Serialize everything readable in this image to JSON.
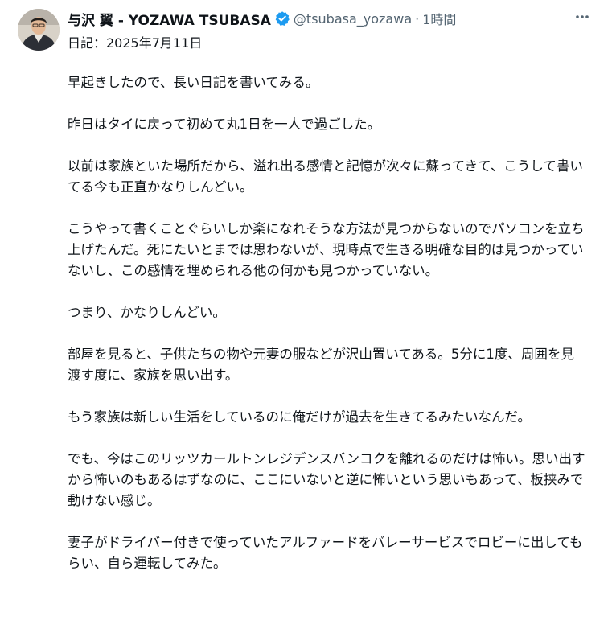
{
  "author": {
    "display_name": "与沢 翼 - YOZAWA TSUBASA",
    "handle": "@tsubasa_yozawa",
    "separator": "·",
    "time_ago": "1時間",
    "verified": true,
    "verified_color": "#1d9bf0"
  },
  "icons": {
    "avatar": "profile-photo",
    "verified": "verified-badge-icon",
    "more": "more-horizontal-icon"
  },
  "post": {
    "diary_date": "日記：2025年7月11日",
    "paragraphs": [
      "早起きしたので、長い日記を書いてみる。",
      "昨日はタイに戻って初めて丸1日を一人で過ごした。",
      "以前は家族といた場所だから、溢れ出る感情と記憶が次々に蘇ってきて、こうして書いてる今も正直かなりしんどい。",
      "こうやって書くことぐらいしか楽になれそうな方法が見つからないのでパソコンを立ち上げたんだ。死にたいとまでは思わないが、現時点で生きる明確な目的は見つかっていないし、この感情を埋められる他の何かも見つかっていない。",
      "つまり、かなりしんどい。",
      "部屋を見ると、子供たちの物や元妻の服などが沢山置いてある。5分に1度、周囲を見渡す度に、家族を思い出す。",
      "もう家族は新しい生活をしているのに俺だけが過去を生きてるみたいなんだ。",
      "でも、今はこのリッツカールトンレジデンスバンコクを離れるのだけは怖い。思い出すから怖いのもあるはずなのに、ここにいないと逆に怖いという思いもあって、板挟みで動けない感じ。",
      "妻子がドライバー付きで使っていたアルファードをバレーサービスでロビーに出してもらい、自ら運転してみた。"
    ]
  }
}
